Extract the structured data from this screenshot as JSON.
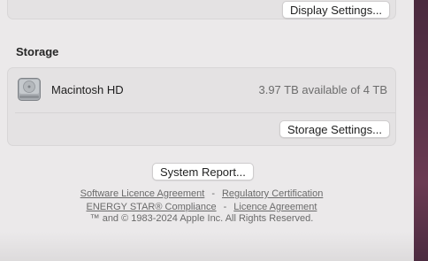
{
  "display": {
    "settings_button": "Display Settings..."
  },
  "storage": {
    "section_title": "Storage",
    "disk_icon": "hard-drive-icon",
    "disk_name": "Macintosh HD",
    "disk_available": "3.97 TB available of 4 TB",
    "settings_button": "Storage Settings..."
  },
  "system_report_button": "System Report...",
  "footer": {
    "link_software_licence": "Software Licence Agreement",
    "separator": "-",
    "link_regulatory": "Regulatory Certification",
    "link_energy_star": "ENERGY STAR® Compliance",
    "link_licence": "Licence Agreement",
    "copyright": "™ and © 1983-2024 Apple Inc. All Rights Reserved."
  },
  "colors": {
    "window_bg": "#ebe9ea",
    "panel_bg": "#e4e2e3",
    "desktop_edge": "#5a3248"
  }
}
